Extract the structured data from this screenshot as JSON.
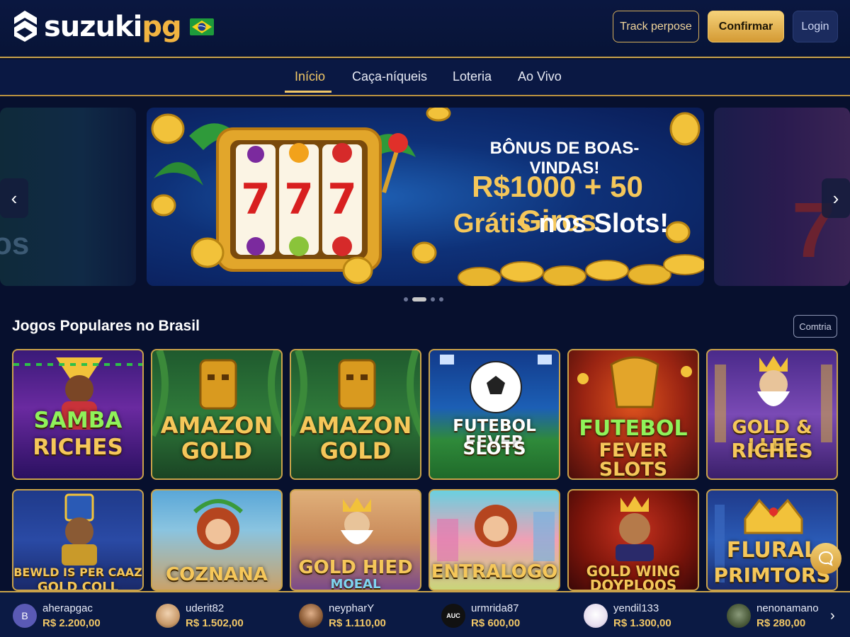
{
  "header": {
    "logo_main": "suzuki",
    "logo_accent": "pg",
    "flag": "brazil-flag-icon",
    "track_label": "Track perpose",
    "confirm_label": "Confirmar",
    "login_label": "Login"
  },
  "nav": {
    "items": [
      {
        "label": "Início",
        "active": true
      },
      {
        "label": "Caça-níqueis",
        "active": false
      },
      {
        "label": "Loteria",
        "active": false
      },
      {
        "label": "Ao Vivo",
        "active": false
      }
    ]
  },
  "banner": {
    "title": "BÔNUS DE BOAS-VINDAS!",
    "line1": "R$1000 + 50 Giros",
    "line2_gold": "Grátis",
    "line2_rest": " nos Slots!",
    "prev_icon": "chevron-left-icon",
    "next_icon": "chevron-right-icon",
    "dots": 4,
    "active_dot": 1
  },
  "section": {
    "title": "Jogos Populares no Brasil",
    "more_label": "Comtria"
  },
  "games_row1": [
    {
      "title_a": "SAMBA",
      "title_b": "RICHES"
    },
    {
      "title_a": "AMAZON",
      "title_b": "GOLD"
    },
    {
      "title_a": "AMAZON",
      "title_b": "GOLD"
    },
    {
      "title_a": "FUTEBOL FEVER",
      "title_b": "SLOTS"
    },
    {
      "title_a": "FUTEBOL",
      "title_b": "FEVER SLOTS"
    },
    {
      "title_a": "GOLD & LLEE",
      "title_b": "RICHES"
    }
  ],
  "games_row2": [
    {
      "title_a": "BEWLD IS PER CAAZ",
      "title_b": "GOLD COLL"
    },
    {
      "title_a": "COZNANA",
      "title_b": ""
    },
    {
      "title_a": "GOLD HIED",
      "title_b": "MOEAL"
    },
    {
      "title_a": "ENTRALOGO",
      "title_b": ""
    },
    {
      "title_a": "GOLD WING",
      "title_b": "DOYPLOOS"
    },
    {
      "title_a": "FLURAL",
      "title_b": "PRIMTORS"
    }
  ],
  "winners": [
    {
      "name": "aherapgac",
      "amount": "R$ 2.200,00",
      "avatar": "B"
    },
    {
      "name": "uderit82",
      "amount": "R$ 1.502,00",
      "avatar": ""
    },
    {
      "name": "neypharY",
      "amount": "R$ 1.110,00",
      "avatar": ""
    },
    {
      "name": "urmrida87",
      "amount": "R$ 600,00",
      "avatar": "AUC"
    },
    {
      "name": "yendil133",
      "amount": "R$ 1.300,00",
      "avatar": ""
    },
    {
      "name": "nenonamano",
      "amount": "R$ 280,00",
      "avatar": ""
    }
  ],
  "colors": {
    "gold": "#f1c766",
    "background": "#07102e",
    "header": "#0a1740"
  }
}
